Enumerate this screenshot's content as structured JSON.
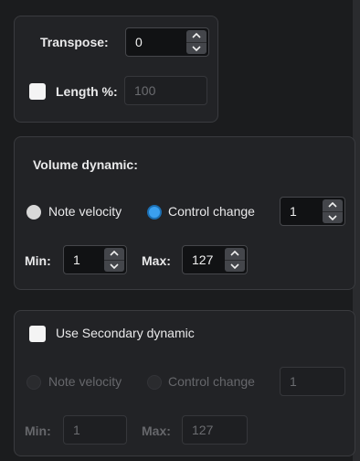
{
  "transpose": {
    "label": "Transpose:",
    "value": "0"
  },
  "length": {
    "label": "Length %:",
    "value": "100",
    "checked": false
  },
  "volume": {
    "title": "Volume dynamic:",
    "note_velocity": "Note velocity",
    "control_change": "Control change",
    "selected": "control_change",
    "cc_value": "1",
    "min_label": "Min:",
    "min_value": "1",
    "max_label": "Max:",
    "max_value": "127"
  },
  "secondary": {
    "checkbox_label": "Use Secondary dynamic",
    "checked": false,
    "note_velocity": "Note velocity",
    "control_change": "Control change",
    "cc_value": "1",
    "min_label": "Min:",
    "min_value": "1",
    "max_label": "Max:",
    "max_value": "127"
  },
  "colors": {
    "accent": "#3aa0f0",
    "panel": "#222326",
    "background": "#1b1c1e"
  }
}
